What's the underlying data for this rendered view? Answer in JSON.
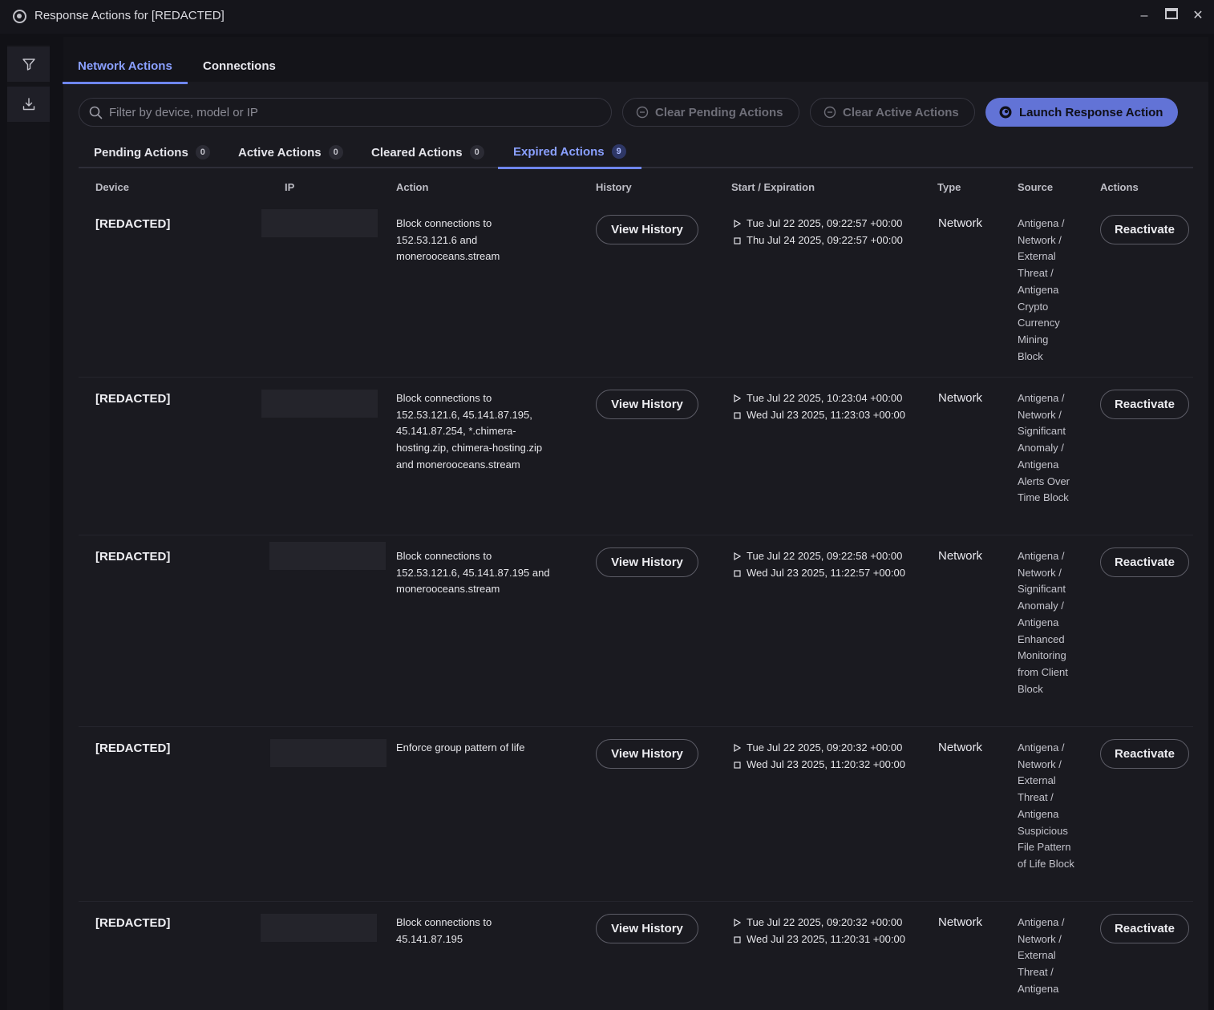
{
  "window": {
    "title": "Response Actions for [REDACTED]",
    "minimize": "–",
    "maximize": "▬",
    "close": "✕"
  },
  "main_tabs": [
    "Network Actions",
    "Connections"
  ],
  "search": {
    "placeholder": "Filter by device, model or IP"
  },
  "toolbar": {
    "clear_pending": "Clear Pending Actions",
    "clear_active": "Clear Active Actions",
    "launch": "Launch Response Action"
  },
  "sub_tabs": [
    {
      "label": "Pending Actions",
      "count": "0"
    },
    {
      "label": "Active Actions",
      "count": "0"
    },
    {
      "label": "Cleared Actions",
      "count": "0"
    },
    {
      "label": "Expired Actions",
      "count": "9"
    }
  ],
  "columns": [
    "Device",
    "IP",
    "Action",
    "History",
    "Start / Expiration",
    "Type",
    "Source",
    "Actions"
  ],
  "rows": [
    {
      "device": "[REDACTED]",
      "action": "Block connections to 152.53.121.6 and monerooceans.stream",
      "history": "View History",
      "start": "Tue Jul 22 2025, 09:22:57 +00:00",
      "expiration": "Thu Jul 24 2025, 09:22:57 +00:00",
      "type": "Network",
      "source": "Antigena / Network / External Threat / Antigena Crypto Currency Mining Block",
      "button": "Reactivate"
    },
    {
      "device": "[REDACTED]",
      "action": "Block connections to 152.53.121.6, 45.141.87.195, 45.141.87.254, *.chimera-hosting.zip, chimera-hosting.zip and monerooceans.stream",
      "history": "View History",
      "start": "Tue Jul 22 2025, 10:23:04 +00:00",
      "expiration": "Wed Jul 23 2025, 11:23:03 +00:00",
      "type": "Network",
      "source": "Antigena / Network / Significant Anomaly / Antigena Alerts Over Time Block",
      "button": "Reactivate"
    },
    {
      "device": "[REDACTED]",
      "action": "Block connections to 152.53.121.6, 45.141.87.195 and monerooceans.stream",
      "history": "View History",
      "start": "Tue Jul 22 2025, 09:22:58 +00:00",
      "expiration": "Wed Jul 23 2025, 11:22:57 +00:00",
      "type": "Network",
      "source": "Antigena / Network / Significant Anomaly / Antigena Enhanced Monitoring from Client Block",
      "button": "Reactivate"
    },
    {
      "device": "[REDACTED]",
      "action": "Enforce group pattern of life",
      "history": "View History",
      "start": "Tue Jul 22 2025, 09:20:32 +00:00",
      "expiration": "Wed Jul 23 2025, 11:20:32 +00:00",
      "type": "Network",
      "source": "Antigena / Network / External Threat / Antigena Suspicious File Pattern of Life Block",
      "button": "Reactivate"
    },
    {
      "device": "[REDACTED]",
      "action": "Block connections to 45.141.87.195",
      "history": "View History",
      "start": "Tue Jul 22 2025, 09:20:32 +00:00",
      "expiration": "Wed Jul 23 2025, 11:20:31 +00:00",
      "type": "Network",
      "source": "Antigena / Network / External Threat / Antigena",
      "button": "Reactivate"
    }
  ]
}
